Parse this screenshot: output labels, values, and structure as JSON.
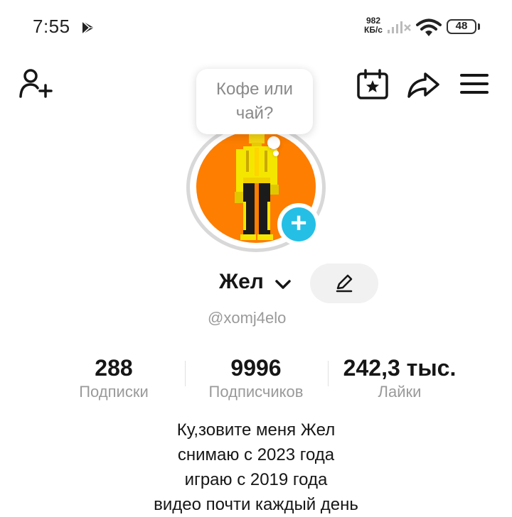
{
  "status_bar": {
    "time": "7:55",
    "speed_value": "982",
    "speed_unit": "КБ/с",
    "battery": "48"
  },
  "header": {
    "bubble_line1": "Кофе или",
    "bubble_line2": "чай?"
  },
  "profile": {
    "display_name": "Жел",
    "username": "@xomj4elo",
    "accent_color": "#25bfe6",
    "avatar_bg_color": "#fd7e00"
  },
  "stats": [
    {
      "value": "288",
      "label": "Подписки"
    },
    {
      "value": "9996",
      "label": "Подписчиков"
    },
    {
      "value": "242,3 тыс.",
      "label": "Лайки"
    }
  ],
  "bio": [
    "Ку,зовите меня Жел",
    "снимаю с 2023 года",
    "играю с 2019 года",
    "видео почти каждый день"
  ],
  "icons": [
    "play-store-icon",
    "signal-icon",
    "wifi-icon",
    "add-friend-icon",
    "calendar-star-icon",
    "share-icon",
    "menu-icon",
    "plus-icon",
    "chevron-down-icon",
    "pencil-icon"
  ]
}
